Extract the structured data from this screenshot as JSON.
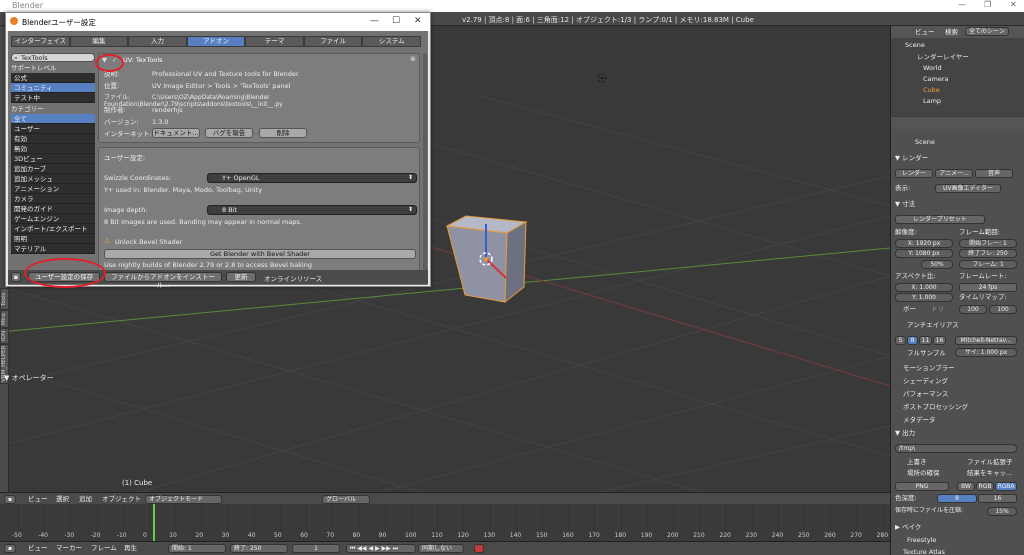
{
  "window": {
    "title": "Blender"
  },
  "topbar": {
    "stats": "v2.79 | 頂点:8 | 面:6 | 三角面:12 | オブジェクト:1/3 | ランプ:0/1 | メモリ:18.83M | Cube"
  },
  "prefs": {
    "title": "Blenderユーザー設定",
    "tabs": [
      "インターフェイス",
      "編集",
      "入力",
      "アドオン",
      "テーマ",
      "ファイル",
      "システム"
    ],
    "active_tab": "アドオン",
    "search_value": "TexTools",
    "support_label": "サポートレベル",
    "support_items": [
      "公式",
      "コミュニティ",
      "テスト中"
    ],
    "category_label": "カテゴリー",
    "categories": [
      "全て",
      "ユーザー",
      "有効",
      "無効",
      "3Dビュー",
      "追加カーブ",
      "追加メッシュ",
      "アニメーション",
      "カメラ",
      "開発のガイド",
      "ゲームエンジン",
      "インポート/エクスポート",
      "照明",
      "マテリアル"
    ],
    "addon": {
      "name": "UV: TexTools",
      "rows": [
        {
          "k": "説明:",
          "v": "Professional UV and Texture tools for Blender."
        },
        {
          "k": "位置:",
          "v": "UV Image Editor > Tools > 'TexTools' panel"
        },
        {
          "k": "ファイル:",
          "v": "C:\\Users\\OZ\\AppData\\Roaming\\Blender Foundation\\Blender\\2.79\\scripts\\addons\\textools\\__init__.py"
        },
        {
          "k": "制作者:",
          "v": "renderhjs"
        },
        {
          "k": "バージョン:",
          "v": "1.3.0"
        },
        {
          "k": "インターネット:",
          "v": ""
        }
      ],
      "btn_doc": "ドキュメント...",
      "btn_bug": "バグを報告",
      "btn_remove": "削除"
    },
    "userpref": {
      "label": "ユーザー設定:",
      "swizzle_label": "Swizzle Coordinates:",
      "swizzle_value": "Y+ OpenGL",
      "swizzle_note": "Y+ used in: Blender, Maya, Modo, Toolbag, Unity",
      "depth_label": "Image depth:",
      "depth_value": "8 Bit",
      "depth_note": "8 Bit images are used. Banding may appear in normal maps.",
      "bevel_label": "Unlock Bevel Shader",
      "bevel_btn": "Get Blender with Bevel Shader",
      "bevel_note": "Use nightly builds of Blender 2.79 or 2.8 to access Bevel baking"
    },
    "footer": {
      "save": "ユーザー設定の保存",
      "install": "ファイルからアドオンをインストール...",
      "refresh": "更新",
      "online": "オンラインリソース"
    }
  },
  "operator_panel": "▼ オペレーター",
  "left_tabs": [
    "Tools",
    "Mira",
    "ION",
    "VRM_HELPER"
  ],
  "viewport": {
    "object_label": "(1) Cube"
  },
  "outliner": {
    "view": "ビュー",
    "search": "検索",
    "scenes": "全てのシーン",
    "items": [
      "Scene",
      "レンダーレイヤー",
      "World",
      "Camera",
      "Cube",
      "Lamp"
    ]
  },
  "properties": {
    "scene": "Scene",
    "render_hdr": "▼ レンダー",
    "render_btns": [
      "レンダー",
      "アニメー...",
      "音声"
    ],
    "display_label": "表示:",
    "display_value": "UV画像エディター",
    "dims_hdr": "▼ 寸法",
    "preset": "レンダープリセット",
    "res_label": "解像度:",
    "res_x": "X:   1920 px",
    "res_y": "Y:   1080 px",
    "res_pct": "50%",
    "frame_label": "フレーム範囲:",
    "frame_start": "開始フレー: 1",
    "frame_end": "終了フレ: 250",
    "frame_step": "フレーム: 1",
    "aspect_label": "アスペクト比:",
    "asp_x": "X:   1.000",
    "asp_y": "Y:   1.000",
    "fps_label": "フレームレート:",
    "fps": "24 fps",
    "remap_label": "タイムリマップ:",
    "remap_a": "100",
    "remap_b": "100",
    "border": "ボー",
    "crop": "ドリ",
    "aa_hdr": "アンチエイリアス",
    "aa_samples": [
      "5",
      "8",
      "11",
      "16"
    ],
    "aa_filter": "Mitchell-Netrav...",
    "full_sample": "フルサンプル",
    "filter_size": "サイ: 1.000 px",
    "collapsed": [
      "モーションブラー",
      "シェーディング",
      "パフォーマンス",
      "ポストプロセッシング",
      "メタデータ"
    ],
    "output_hdr": "▼ 出力",
    "output_path": "/tmp\\",
    "overwrite": "上書き",
    "ext": "ファイル拡張子",
    "placeholders": "場所の確保",
    "cache": "結果をキャッ...",
    "format": "PNG",
    "modes": [
      "BW",
      "RGB",
      "RGBA"
    ],
    "depth_label": "色深度:",
    "depth_a": "8",
    "depth_b": "16",
    "compress": "保存時にファイルを圧縮:",
    "compress_val": "15%",
    "bake_hdr": "▶ ベイク",
    "freestyle": "Freestyle",
    "texatlas": "Texture Atlas"
  },
  "view_header": {
    "view": "ビュー",
    "select": "選択",
    "add": "追加",
    "object": "オブジェクト",
    "mode": "オブジェクトモード",
    "orient": "グローバル"
  },
  "timeline": {
    "ticks": [
      "-50",
      "-40",
      "-30",
      "-20",
      "-10",
      "0",
      "10",
      "20",
      "30",
      "40",
      "50",
      "60",
      "70",
      "80",
      "90",
      "100",
      "110",
      "120",
      "130",
      "140",
      "150",
      "160",
      "170",
      "180",
      "190",
      "200",
      "210",
      "220",
      "230",
      "240",
      "250",
      "260",
      "270",
      "280"
    ]
  },
  "time_header": {
    "view": "ビュー",
    "marker": "マーカー",
    "frame": "フレーム",
    "play": "再生",
    "start": "開始:",
    "start_v": "1",
    "end": "終了:",
    "end_v": "250",
    "cur": "1",
    "sync": "同期しない"
  },
  "colors": {
    "accent": "#5680c2",
    "annotation": "#e0202a"
  }
}
